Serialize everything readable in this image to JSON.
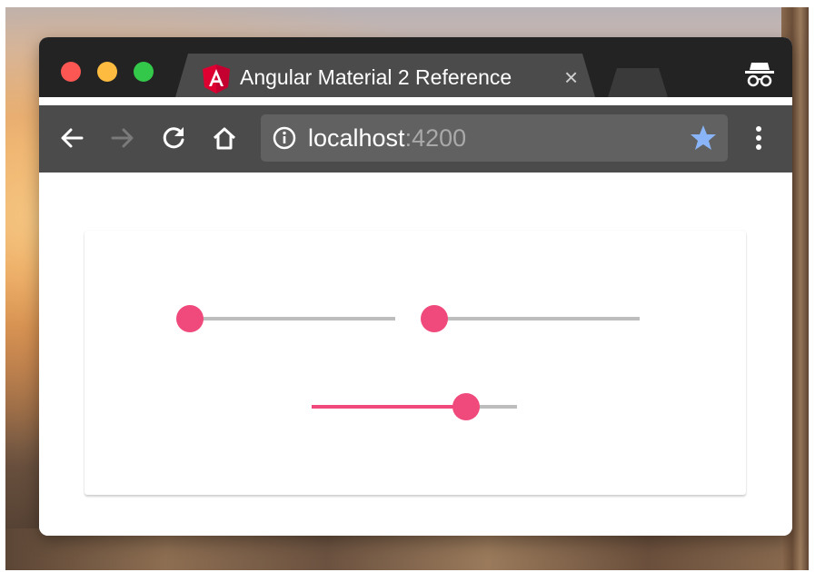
{
  "browser": {
    "tab_title": "Angular Material 2 Reference",
    "tab_close": "×",
    "url_host": "localhost",
    "url_port": ":4200"
  },
  "icons": {
    "back": "arrow-left-icon",
    "forward": "arrow-right-icon",
    "reload": "reload-icon",
    "home": "home-icon",
    "info": "info-icon",
    "bookmark": "star-icon",
    "menu": "more-vert-icon",
    "incognito": "incognito-icon",
    "tab_favicon": "angular-logo-icon"
  },
  "colors": {
    "accent": "#f04a7c",
    "track": "#bdbdbd",
    "star": "#8ab4f8"
  },
  "sliders": [
    {
      "value": 0,
      "min": 0,
      "max": 100
    },
    {
      "value": 0,
      "min": 0,
      "max": 100
    },
    {
      "value": 75,
      "min": 0,
      "max": 100
    }
  ]
}
